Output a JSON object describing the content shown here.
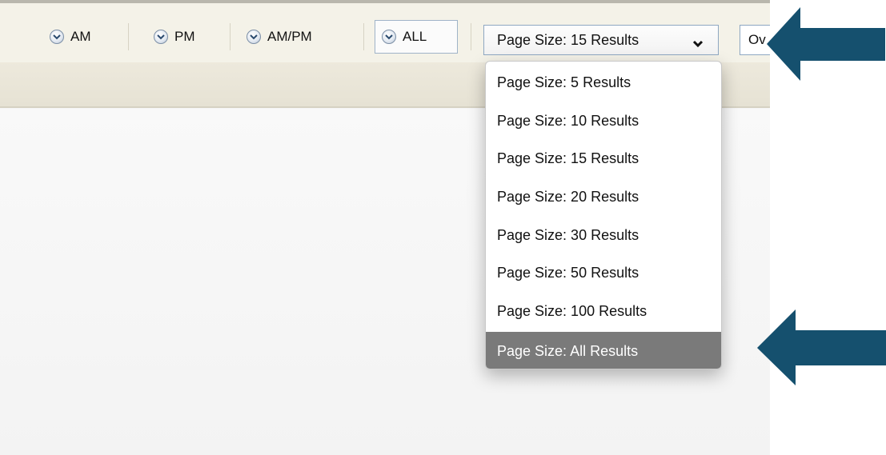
{
  "toolbar": {
    "buttons": [
      {
        "label": "AM",
        "icon": "clock-icon",
        "selected": false
      },
      {
        "label": "PM",
        "icon": "clock-icon",
        "selected": false
      },
      {
        "label": "AM/PM",
        "icon": "clock-icon",
        "selected": false
      },
      {
        "label": "ALL",
        "icon": "clock-icon",
        "selected": true
      }
    ]
  },
  "page_size": {
    "selected_label": "Page Size: 15 Results",
    "options": [
      "Page Size: 5 Results",
      "Page Size: 10 Results",
      "Page Size: 15 Results",
      "Page Size: 20 Results",
      "Page Size: 30 Results",
      "Page Size: 50 Results",
      "Page Size: 100 Results",
      "Page Size: All Results"
    ],
    "highlighted_option": "Page Size: All Results"
  },
  "partial_field": {
    "visible_text": "Ov"
  },
  "annotations": {
    "arrow_color": "#15506e"
  },
  "colors": {
    "highlight": "#7a7a7a",
    "select_border": "#8ea7c2"
  }
}
